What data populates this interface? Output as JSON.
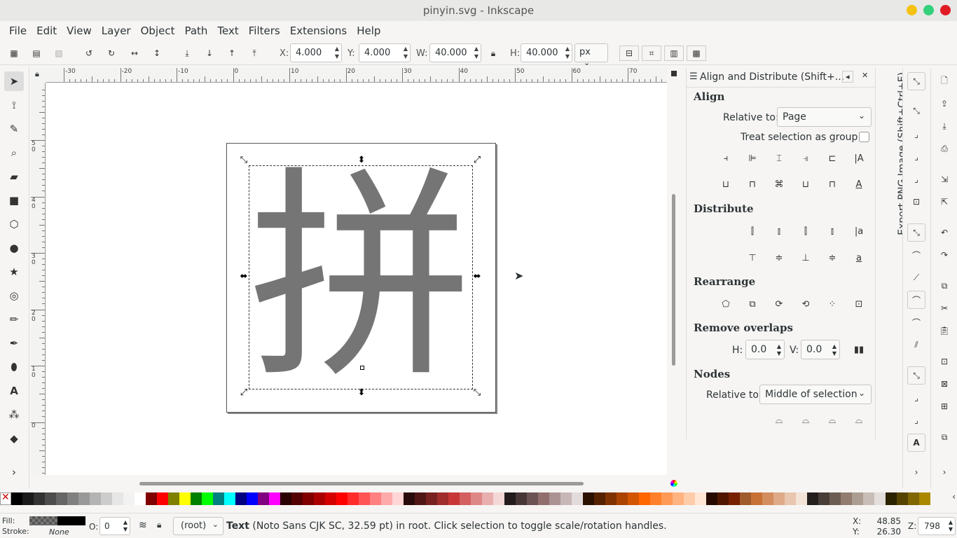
{
  "window": {
    "title": "pinyin.svg - Inkscape"
  },
  "menu": [
    "File",
    "Edit",
    "View",
    "Layer",
    "Object",
    "Path",
    "Text",
    "Filters",
    "Extensions",
    "Help"
  ],
  "toolbar": {
    "x_label": "X:",
    "x_value": "4.000",
    "y_label": "Y:",
    "y_value": "4.000",
    "w_label": "W:",
    "w_value": "40.000",
    "h_label": "H:",
    "h_value": "40.000",
    "unit": "px"
  },
  "ruler_top": [
    "-30",
    "-20",
    "-10",
    "0",
    "10",
    "20",
    "30",
    "40",
    "50",
    "60",
    "70"
  ],
  "ruler_left": [
    "5\n0",
    "4\n0",
    "3\n0",
    "2\n0",
    "1\n0",
    "0"
  ],
  "canvas": {
    "glyph": "拼"
  },
  "dock": {
    "title": "Align and Distribute (Shift+...",
    "align_heading": "Align",
    "relative_to_label": "Relative to:",
    "relative_to_value": "Page",
    "treat_group_label": "Treat selection as group:",
    "distribute_heading": "Distribute",
    "rearrange_heading": "Rearrange",
    "remove_overlaps_heading": "Remove overlaps",
    "h_label": "H:",
    "h_value": "0.0",
    "v_label": "V:",
    "v_value": "0.0",
    "nodes_heading": "Nodes",
    "nodes_relative_label": "Relative to:",
    "nodes_relative_value": "Middle of selection"
  },
  "export_tab": "Export PNG Image (Shift+Ctrl+E)",
  "palette": [
    "#000000",
    "#1a1a1a",
    "#333333",
    "#4d4d4d",
    "#666666",
    "#808080",
    "#999999",
    "#b3b3b3",
    "#cccccc",
    "#e6e6e6",
    "#f2f2f2",
    "#ffffff",
    "#800000",
    "#ff0000",
    "#808000",
    "#ffff00",
    "#008000",
    "#00ff00",
    "#008080",
    "#00ffff",
    "#000080",
    "#0000ff",
    "#800080",
    "#ff00ff",
    "#2b0000",
    "#550000",
    "#800000",
    "#aa0000",
    "#d40000",
    "#ff0000",
    "#ff2a2a",
    "#ff5555",
    "#ff8080",
    "#ffaaaa",
    "#ffd5d5",
    "#280b0b",
    "#501616",
    "#782121",
    "#a02c2c",
    "#c83737",
    "#d35f5f",
    "#de8787",
    "#e9afaf",
    "#f4d7d7",
    "#241c1c",
    "#483737",
    "#6c5353",
    "#916f6f",
    "#ac9393",
    "#c8b7b7",
    "#e3dbdb",
    "#2b1100",
    "#552200",
    "#803300",
    "#aa4400",
    "#d45500",
    "#ff6600",
    "#ff7f2a",
    "#ff9955",
    "#ffb380",
    "#ffccaa",
    "#ffe6d5",
    "#280b00",
    "#501600",
    "#782100",
    "#a05a2c",
    "#c87137",
    "#d38d5f",
    "#deaa87",
    "#e9c6af",
    "#f4e3d7",
    "#241f1c",
    "#483e37",
    "#6c5d53",
    "#917c6f",
    "#ac9d93",
    "#c8beb7",
    "#e3dedb",
    "#2b2200",
    "#554400",
    "#806600",
    "#aa8800"
  ],
  "status": {
    "fill_label": "Fill:",
    "stroke_label": "Stroke:",
    "stroke_value": "None",
    "opacity_label": "O:",
    "opacity_value": "0",
    "layer": "(root)",
    "message_bold": "Text",
    "message": " (Noto Sans CJK SC, 32.59 pt) in root. Click selection to toggle scale/rotation handles.",
    "x_label": "X:",
    "x_value": "48.85",
    "y_label": "Y:",
    "y_value": "26.30",
    "z_label": "Z:",
    "z_value": "798"
  }
}
